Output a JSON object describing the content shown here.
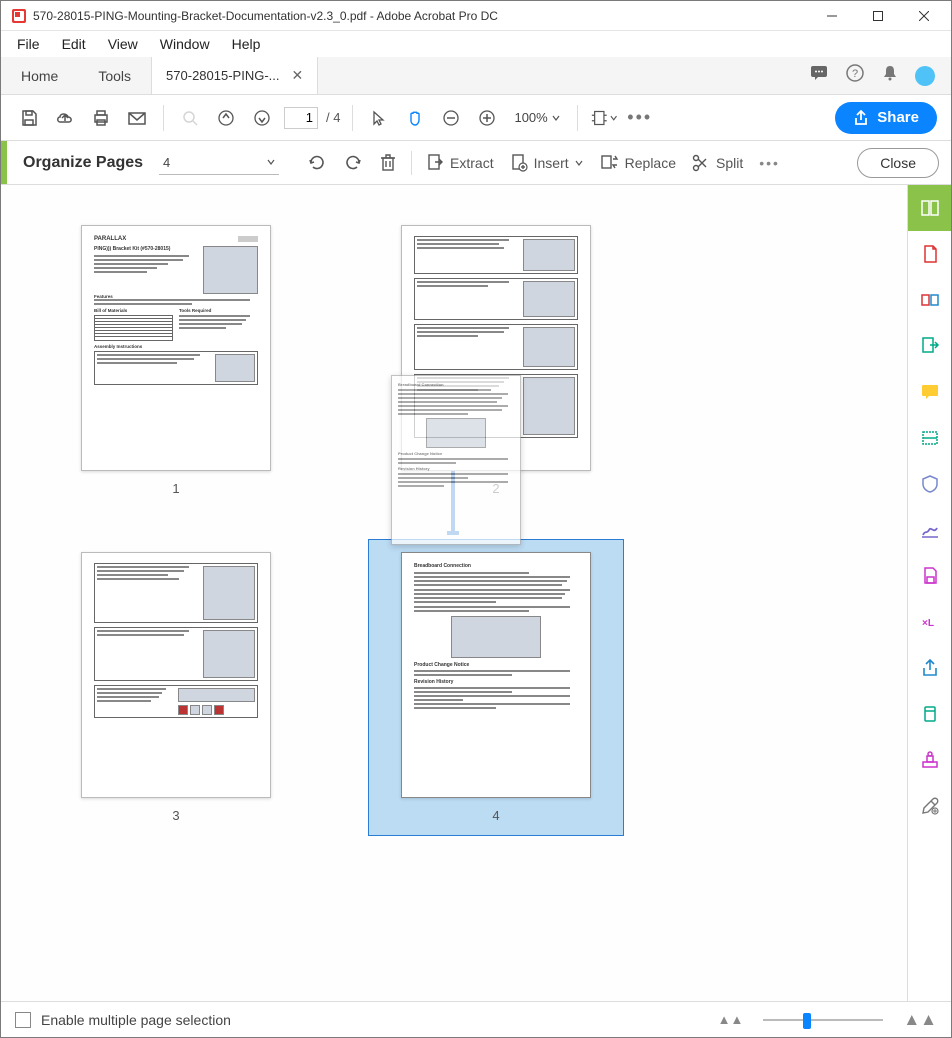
{
  "window": {
    "title": "570-28015-PING-Mounting-Bracket-Documentation-v2.3_0.pdf - Adobe Acrobat Pro DC"
  },
  "menubar": [
    "File",
    "Edit",
    "View",
    "Window",
    "Help"
  ],
  "tabs": {
    "home": "Home",
    "tools": "Tools",
    "doc": "570-28015-PING-..."
  },
  "toolbar": {
    "pageCurrent": "1",
    "pageTotal": "/ 4",
    "zoom": "100%",
    "share": "Share"
  },
  "orgbar": {
    "title": "Organize Pages",
    "pageSelect": "4",
    "extract": "Extract",
    "insert": "Insert",
    "replace": "Replace",
    "split": "Split",
    "close": "Close"
  },
  "thumbnails": {
    "labels": [
      "1",
      "2",
      "3",
      "4"
    ],
    "page1_title": "PING))) Bracket Kit (#570-28015)",
    "page1_brand": "PARALLAX",
    "page1_sec1": "Features",
    "page1_sec2": "Bill of Materials",
    "page1_sec3": "Tools Required",
    "page1_sec4": "Assembly Instructions",
    "page4_h1": "Breadboard Connection",
    "page4_h2": "Product Change Notice",
    "page4_h3": "Revision History"
  },
  "bottombar": {
    "checkboxLabel": "Enable multiple page selection"
  }
}
